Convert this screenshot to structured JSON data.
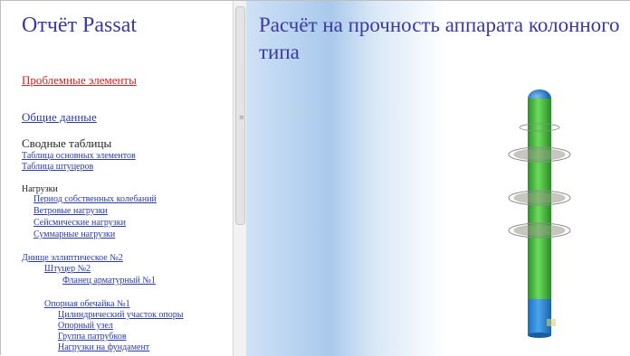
{
  "sidebar": {
    "title": "Отчёт Passat",
    "problem_link": "Проблемные элементы",
    "general_link": "Общие данные",
    "summary_heading": "Сводные таблицы",
    "summary_items": [
      "Таблица основных элементов",
      "Таблица штуцеров"
    ],
    "loads_heading": "Нагрузки",
    "loads_items": [
      "Период собственных колебаний",
      "Ветровые нагрузки",
      "Сейсмические нагрузки",
      "Суммарные нагрузки"
    ],
    "bottom_link": "Днище эллиптическое №2",
    "nozzle_link": "Штуцер №2",
    "flange_link": "Фланец арматурный №1",
    "support_link": "Опорная обечайка №1",
    "support_items": [
      "Цилиндрический участок опоры",
      "Опорный узел",
      "Группа патрубков",
      "Нагрузки на фундамент"
    ]
  },
  "main": {
    "title": "Расчёт на прочность аппарата колонного типа"
  },
  "colors": {
    "title": "#3a3aa0",
    "link": "#2a3aa6",
    "problem": "#d02020",
    "column": "#3fb83a",
    "base": "#2f86d6"
  },
  "icons": {
    "scroll_grip": "grip-lines-icon"
  }
}
